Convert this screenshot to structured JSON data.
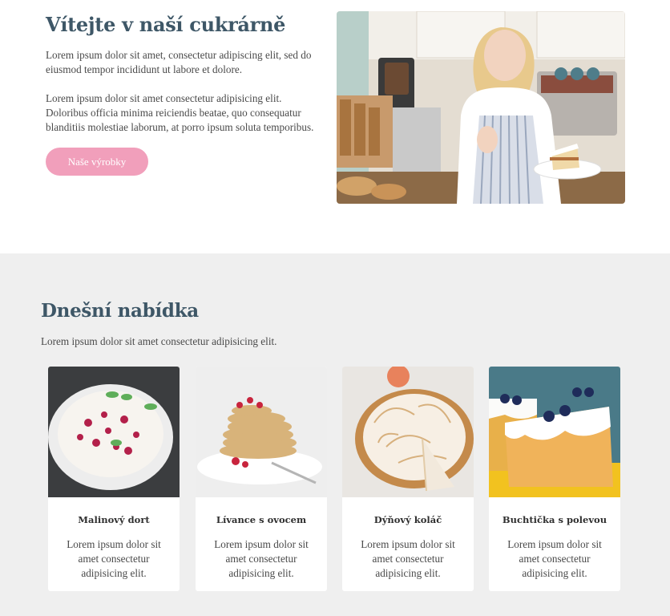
{
  "hero": {
    "title": "Vítejte v naší cukrárně",
    "paragraph1": "Lorem ipsum dolor sit amet, consectetur adipiscing elit, sed do eiusmod tempor incididunt ut labore et dolore.",
    "paragraph2": "Lorem ipsum dolor sit amet consectetur adipisicing elit. Doloribus officia minima reiciendis beatae, quo consequatur blanditiis molestiae laborum, at porro ipsum soluta temporibus.",
    "button_label": "Naše výrobky"
  },
  "offers": {
    "title": "Dnešní nabídka",
    "subtitle": "Lorem ipsum dolor sit amet consectetur adipisicing elit.",
    "items": [
      {
        "name": "Malinový dort",
        "description": "Lorem ipsum dolor sit amet consectetur adipisicing elit."
      },
      {
        "name": "Lívance s ovocem",
        "description": "Lorem ipsum dolor sit amet consectetur adipisicing elit."
      },
      {
        "name": "Dýňový koláč",
        "description": "Lorem ipsum dolor sit amet consectetur adipisicing elit."
      },
      {
        "name": "Buchtička s polevou",
        "description": "Lorem ipsum dolor sit amet consectetur adipisicing elit."
      }
    ]
  },
  "colors": {
    "heading": "#3e5767",
    "button": "#f19fbb",
    "section_bg": "#efefef"
  }
}
